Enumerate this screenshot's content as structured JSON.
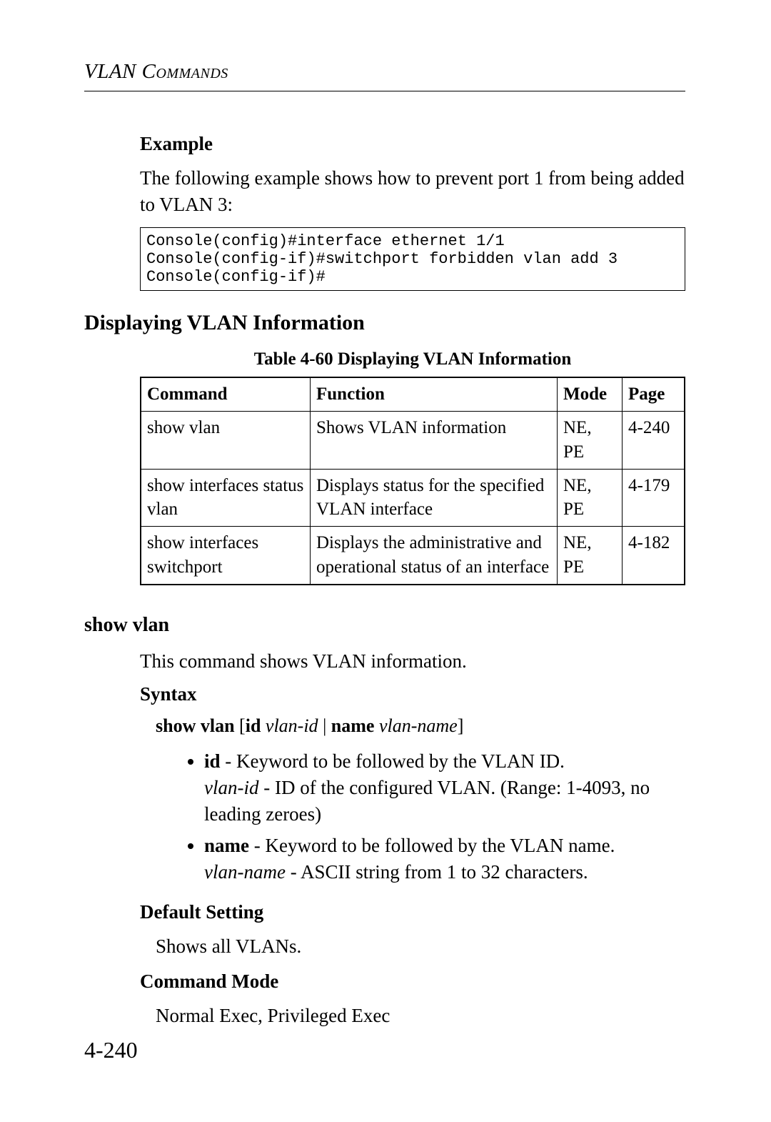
{
  "running_head": "VLAN Commands",
  "example": {
    "heading": "Example",
    "intro": "The following example shows how to prevent port 1 from being added to VLAN 3:",
    "code": "Console(config)#interface ethernet 1/1\nConsole(config-if)#switchport forbidden vlan add 3\nConsole(config-if)#"
  },
  "section_heading": "Displaying VLAN Information",
  "table": {
    "caption": "Table 4-60   Displaying VLAN Information",
    "headers": {
      "command": "Command",
      "function": "Function",
      "mode": "Mode",
      "page": "Page"
    },
    "rows": [
      {
        "command": "show vlan",
        "function": "Shows VLAN information",
        "mode": "NE, PE",
        "page": "4-240"
      },
      {
        "command": "show interfaces status vlan",
        "function": "Displays status for the specified VLAN interface",
        "mode": "NE, PE",
        "page": "4-179"
      },
      {
        "command": "show interfaces switchport",
        "function": "Displays the administrative and operational status of an interface",
        "mode": "NE, PE",
        "page": "4-182"
      }
    ]
  },
  "command": {
    "name": "show vlan",
    "desc": "This command shows VLAN information.",
    "syntax": {
      "heading": "Syntax",
      "parts": {
        "p1": "show vlan",
        "p2": "[",
        "p3": "id",
        "p4": "vlan-id",
        "p5": "|",
        "p6": "name",
        "p7": "vlan-name",
        "p8": "]"
      },
      "bullets": [
        {
          "kw": "id",
          "rest": " - Keyword to be followed by the VLAN ID.",
          "arg": "vlan-id",
          "argrest": " - ID of the configured VLAN. (Range: 1-4093, no leading zeroes)"
        },
        {
          "kw": "name",
          "rest": " - Keyword to be followed by the VLAN name.",
          "arg": "vlan-name",
          "argrest": " - ASCII string from 1 to 32 characters."
        }
      ]
    },
    "default": {
      "heading": "Default Setting",
      "text": "Shows all VLANs."
    },
    "mode": {
      "heading": "Command Mode",
      "text": "Normal Exec, Privileged Exec"
    }
  },
  "pagenum": "4-240"
}
